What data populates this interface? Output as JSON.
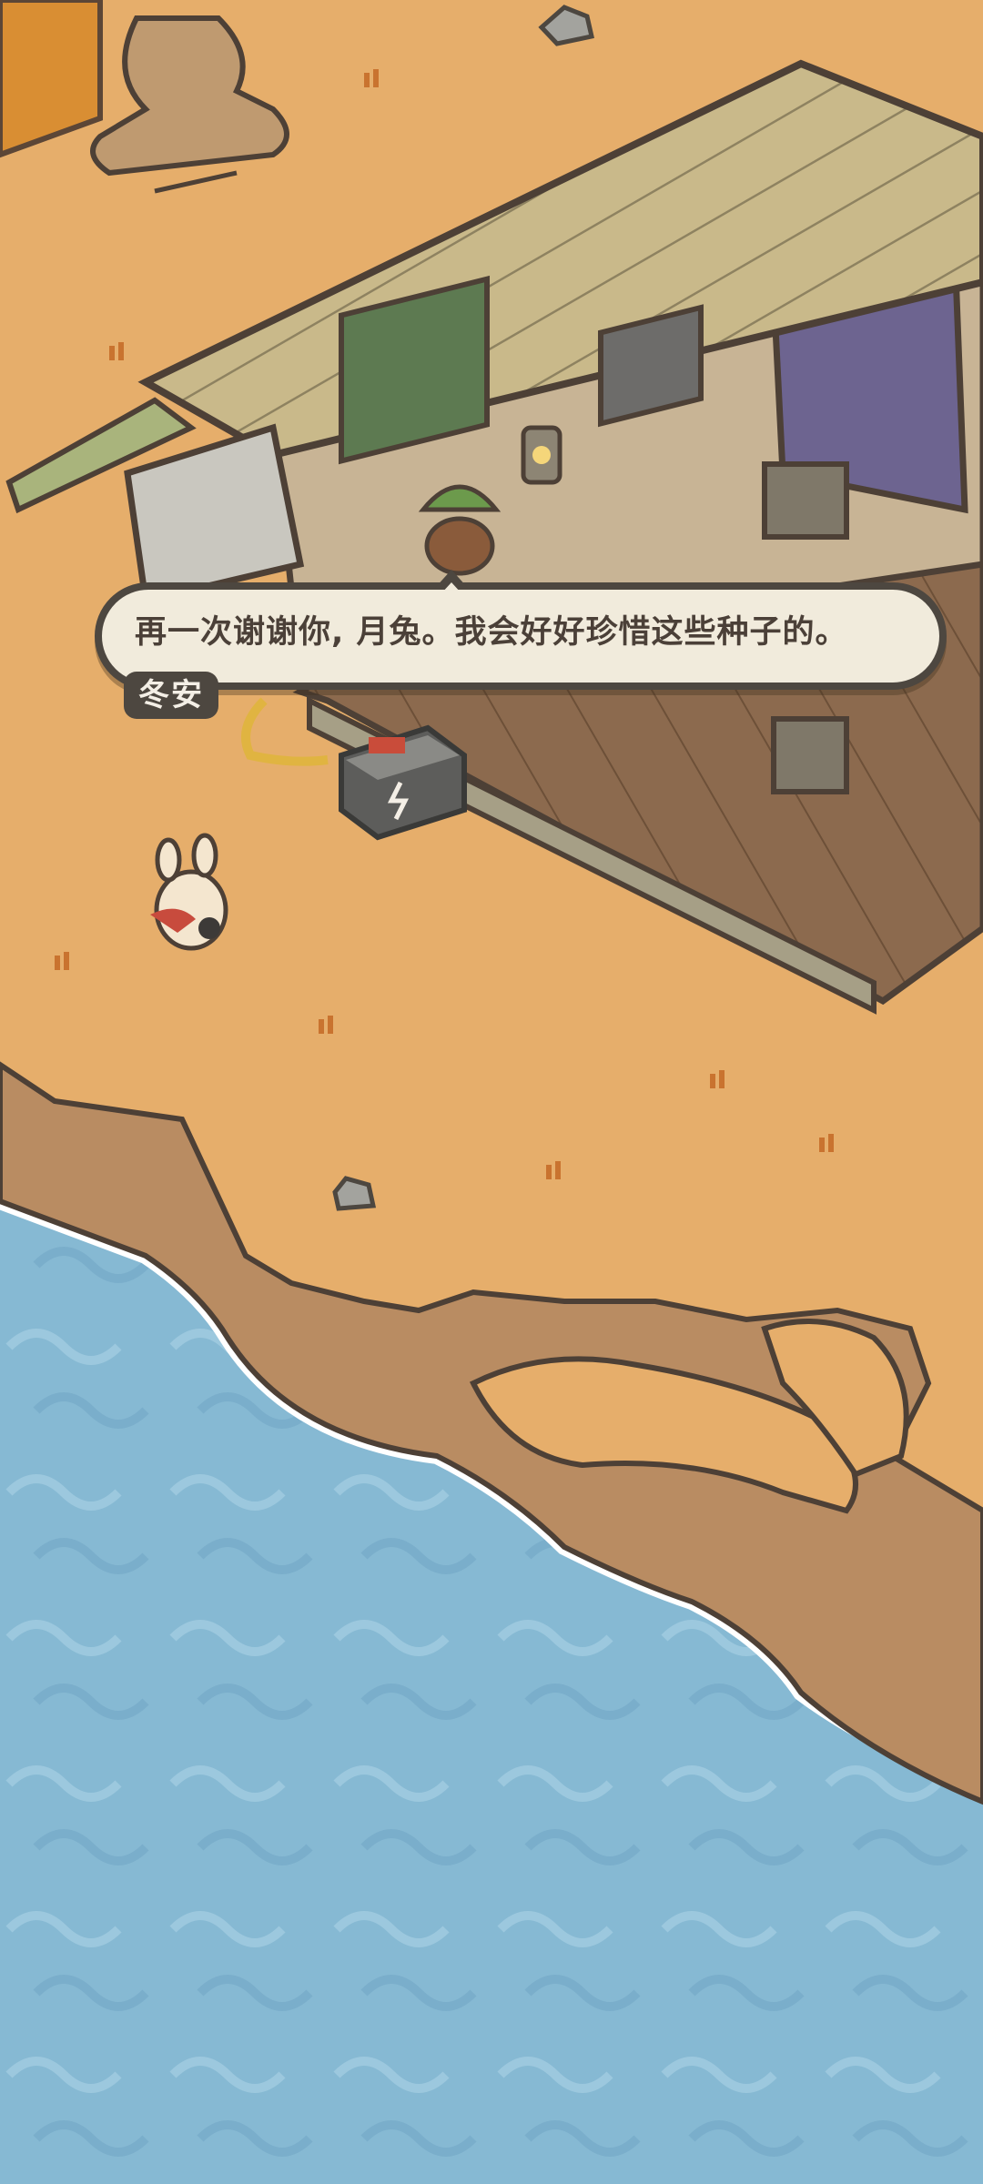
{
  "dialogue": {
    "text": "再一次谢谢你, 月兔。我会好好珍惜这些种子的。",
    "speaker": "冬安"
  },
  "colors": {
    "sand": "#e6ae6b",
    "sea": "#86b9d3",
    "cliff": "#b98c62",
    "deck": "#8c6a4e",
    "roof": "#c9b98a",
    "outline": "#4d4740",
    "dialogue_bg": "#f1ebdc",
    "dialogue_text": "#4b4038"
  },
  "icons": {
    "battery": "battery-icon",
    "lantern": "lantern-icon"
  }
}
